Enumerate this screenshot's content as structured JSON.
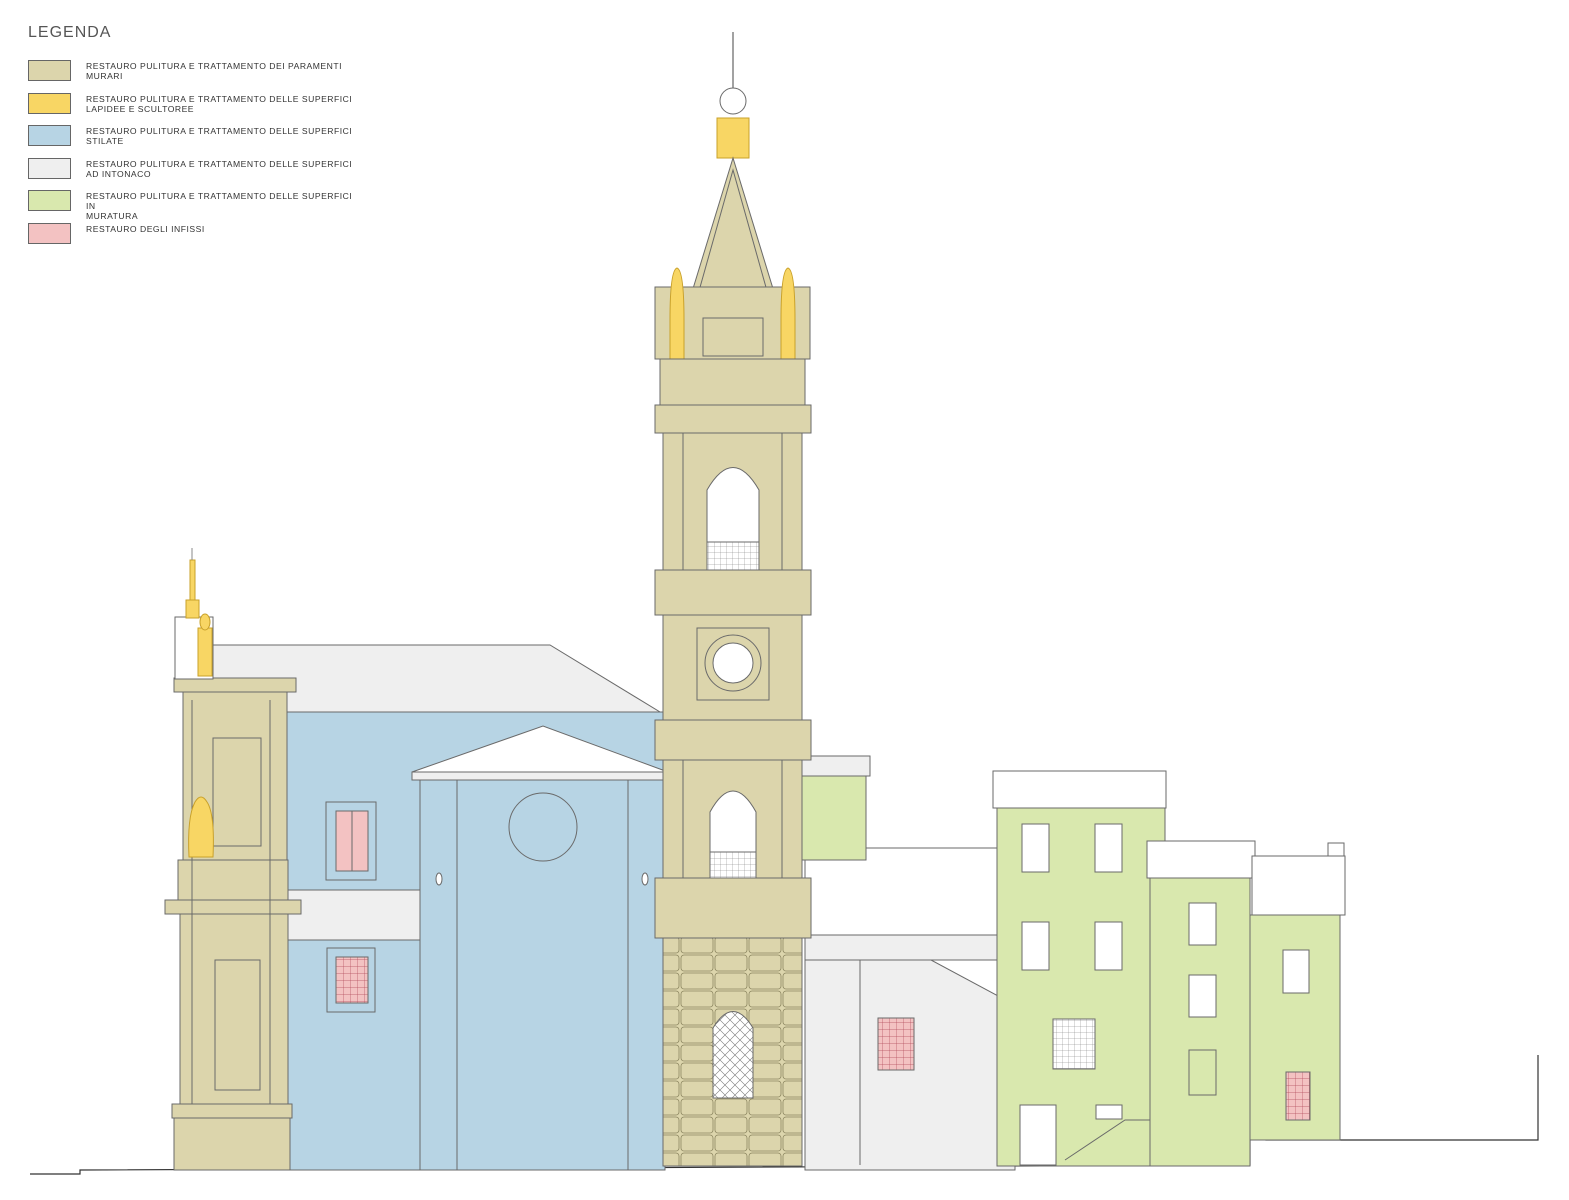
{
  "legend": {
    "title": "LEGENDA",
    "items": [
      {
        "label": "RESTAURO  PULITURA  E  TRATTAMENTO  DEI  PARAMENTI\nMURARI",
        "color": "#dcd5ac"
      },
      {
        "label": "RESTAURO  PULITURA  E  TRATTAMENTO  DELLE  SUPERFICI\nLAPIDEE  E  SCULTOREE",
        "color": "#f8d664"
      },
      {
        "label": "RESTAURO  PULITURA  E  TRATTAMENTO  DELLE  SUPERFICI\nSTILATE",
        "color": "#b7d4e4"
      },
      {
        "label": "RESTAURO  PULITURA  E  TRATTAMENTO  DELLE  SUPERFICI\nAD  INTONACO",
        "color": "#efefef"
      },
      {
        "label": "RESTAURO  PULITURA  E  TRATTAMENTO  DELLE  SUPERFICI  IN\nMURATURA",
        "color": "#d9e8ae"
      },
      {
        "label": "RESTAURO  DEGLI  INFISSI",
        "color": "#f3c2c2"
      }
    ]
  },
  "colors": {
    "stone": "#dcd5ac",
    "gold": "#f8d664",
    "blue": "#b7d4e4",
    "plaster": "#efefef",
    "green": "#d9e8ae",
    "pink": "#f3c2c2",
    "line": "#6a6a6a"
  }
}
